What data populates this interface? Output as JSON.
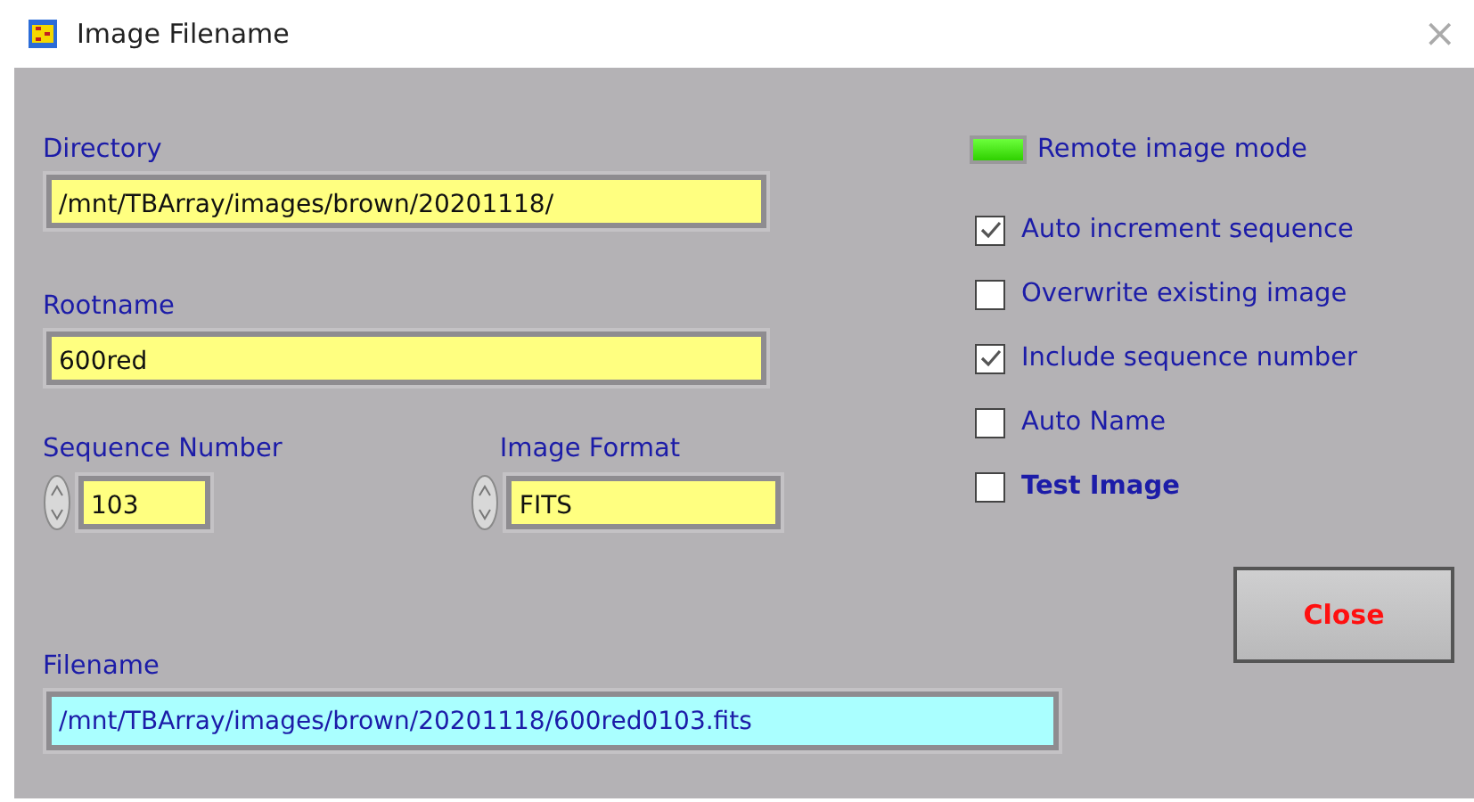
{
  "window": {
    "title": "Image Filename",
    "close_glyph": "×"
  },
  "directory": {
    "label": "Directory",
    "value": "/mnt/TBArray/images/brown/20201118/"
  },
  "rootname": {
    "label": "Rootname",
    "value": "600red"
  },
  "sequence_number": {
    "label": "Sequence Number",
    "value": "103"
  },
  "image_format": {
    "label": "Image Format",
    "value": "FITS"
  },
  "filename": {
    "label": "Filename",
    "value": "/mnt/TBArray/images/brown/20201118/600red0103.fits"
  },
  "remote_mode": {
    "label": "Remote image mode",
    "on": true
  },
  "options": [
    {
      "label": "Auto increment sequence",
      "checked": true,
      "emphasis": false
    },
    {
      "label": "Overwrite existing image",
      "checked": false,
      "emphasis": false
    },
    {
      "label": "Include sequence number",
      "checked": true,
      "emphasis": false
    },
    {
      "label": "Auto Name",
      "checked": false,
      "emphasis": false
    },
    {
      "label": "Test Image",
      "checked": false,
      "emphasis": true
    }
  ],
  "close_button": {
    "label": "Close"
  }
}
